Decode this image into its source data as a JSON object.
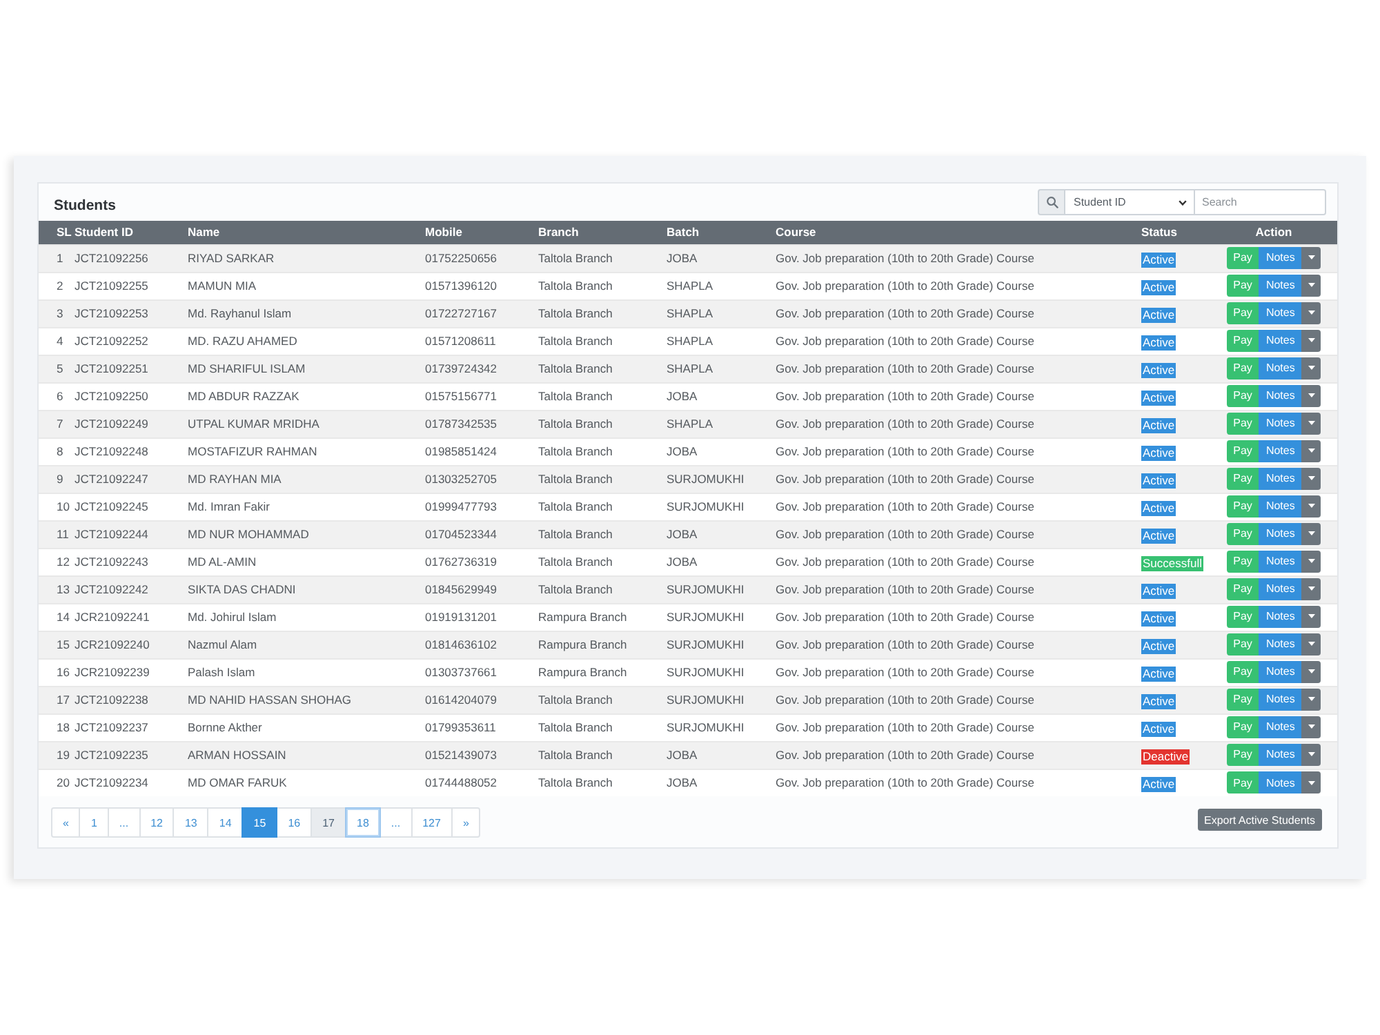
{
  "card": {
    "title": "Students",
    "search": {
      "filter": "Student ID",
      "placeholder": "Search"
    }
  },
  "table": {
    "columns": [
      "SL",
      "Student ID",
      "Name",
      "Mobile",
      "Branch",
      "Batch",
      "Course",
      "Status",
      "Action"
    ],
    "rows": [
      {
        "sl": "1",
        "student_id": "JCT21092256",
        "name": "RIYAD SARKAR",
        "mobile": "01752250656",
        "branch": "Taltola Branch",
        "batch": "JOBA",
        "course": "Gov. Job preparation (10th to 20th Grade) Course",
        "status": {
          "label": "Active",
          "color": "#3490dc"
        },
        "pay": "Pay",
        "notes": "Notes"
      },
      {
        "sl": "2",
        "student_id": "JCT21092255",
        "name": "MAMUN MIA",
        "mobile": "01571396120",
        "branch": "Taltola Branch",
        "batch": "SHAPLA",
        "course": "Gov. Job preparation (10th to 20th Grade) Course",
        "status": {
          "label": "Active",
          "color": "#3490dc"
        },
        "pay": "Pay",
        "notes": "Notes"
      },
      {
        "sl": "3",
        "student_id": "JCT21092253",
        "name": "Md. Rayhanul Islam",
        "mobile": "01722727167",
        "branch": "Taltola Branch",
        "batch": "SHAPLA",
        "course": "Gov. Job preparation (10th to 20th Grade) Course",
        "status": {
          "label": "Active",
          "color": "#3490dc"
        },
        "pay": "Pay",
        "notes": "Notes"
      },
      {
        "sl": "4",
        "student_id": "JCT21092252",
        "name": "MD. RAZU AHAMED",
        "mobile": "01571208611",
        "branch": "Taltola Branch",
        "batch": "SHAPLA",
        "course": "Gov. Job preparation (10th to 20th Grade) Course",
        "status": {
          "label": "Active",
          "color": "#3490dc"
        },
        "pay": "Pay",
        "notes": "Notes"
      },
      {
        "sl": "5",
        "student_id": "JCT21092251",
        "name": "MD SHARIFUL ISLAM",
        "mobile": "01739724342",
        "branch": "Taltola Branch",
        "batch": "SHAPLA",
        "course": "Gov. Job preparation (10th to 20th Grade) Course",
        "status": {
          "label": "Active",
          "color": "#3490dc"
        },
        "pay": "Pay",
        "notes": "Notes"
      },
      {
        "sl": "6",
        "student_id": "JCT21092250",
        "name": "MD ABDUR RAZZAK",
        "mobile": "01575156771",
        "branch": "Taltola Branch",
        "batch": "JOBA",
        "course": "Gov. Job preparation (10th to 20th Grade) Course",
        "status": {
          "label": "Active",
          "color": "#3490dc"
        },
        "pay": "Pay",
        "notes": "Notes"
      },
      {
        "sl": "7",
        "student_id": "JCT21092249",
        "name": "UTPAL KUMAR MRIDHA",
        "mobile": "01787342535",
        "branch": "Taltola Branch",
        "batch": "SHAPLA",
        "course": "Gov. Job preparation (10th to 20th Grade) Course",
        "status": {
          "label": "Active",
          "color": "#3490dc"
        },
        "pay": "Pay",
        "notes": "Notes"
      },
      {
        "sl": "8",
        "student_id": "JCT21092248",
        "name": "MOSTAFIZUR RAHMAN",
        "mobile": "01985851424",
        "branch": "Taltola Branch",
        "batch": "JOBA",
        "course": "Gov. Job preparation (10th to 20th Grade) Course",
        "status": {
          "label": "Active",
          "color": "#3490dc"
        },
        "pay": "Pay",
        "notes": "Notes"
      },
      {
        "sl": "9",
        "student_id": "JCT21092247",
        "name": "MD RAYHAN MIA",
        "mobile": "01303252705",
        "branch": "Taltola Branch",
        "batch": "SURJOMUKHI",
        "course": "Gov. Job preparation (10th to 20th Grade) Course",
        "status": {
          "label": "Active",
          "color": "#3490dc"
        },
        "pay": "Pay",
        "notes": "Notes"
      },
      {
        "sl": "10",
        "student_id": "JCT21092245",
        "name": "Md. Imran Fakir",
        "mobile": "01999477793",
        "branch": "Taltola Branch",
        "batch": "SURJOMUKHI",
        "course": "Gov. Job preparation (10th to 20th Grade) Course",
        "status": {
          "label": "Active",
          "color": "#3490dc"
        },
        "pay": "Pay",
        "notes": "Notes"
      },
      {
        "sl": "11",
        "student_id": "JCT21092244",
        "name": "MD NUR MOHAMMAD",
        "mobile": "01704523344",
        "branch": "Taltola Branch",
        "batch": "JOBA",
        "course": "Gov. Job preparation (10th to 20th Grade) Course",
        "status": {
          "label": "Active",
          "color": "#3490dc"
        },
        "pay": "Pay",
        "notes": "Notes"
      },
      {
        "sl": "12",
        "student_id": "JCT21092243",
        "name": "MD AL-AMIN",
        "mobile": "01762736319",
        "branch": "Taltola Branch",
        "batch": "JOBA",
        "course": "Gov. Job preparation (10th to 20th Grade) Course",
        "status": {
          "label": "Successfull",
          "color": "#38c172"
        },
        "pay": "Pay",
        "notes": "Notes"
      },
      {
        "sl": "13",
        "student_id": "JCT21092242",
        "name": "SIKTA DAS CHADNI",
        "mobile": "01845629949",
        "branch": "Taltola Branch",
        "batch": "SURJOMUKHI",
        "course": "Gov. Job preparation (10th to 20th Grade) Course",
        "status": {
          "label": "Active",
          "color": "#3490dc"
        },
        "pay": "Pay",
        "notes": "Notes"
      },
      {
        "sl": "14",
        "student_id": "JCR21092241",
        "name": "Md. Johirul Islam",
        "mobile": "01919131201",
        "branch": "Rampura Branch",
        "batch": "SURJOMUKHI",
        "course": "Gov. Job preparation (10th to 20th Grade) Course",
        "status": {
          "label": "Active",
          "color": "#3490dc"
        },
        "pay": "Pay",
        "notes": "Notes"
      },
      {
        "sl": "15",
        "student_id": "JCR21092240",
        "name": "Nazmul Alam",
        "mobile": "01814636102",
        "branch": "Rampura Branch",
        "batch": "SURJOMUKHI",
        "course": "Gov. Job preparation (10th to 20th Grade) Course",
        "status": {
          "label": "Active",
          "color": "#3490dc"
        },
        "pay": "Pay",
        "notes": "Notes"
      },
      {
        "sl": "16",
        "student_id": "JCR21092239",
        "name": "Palash Islam",
        "mobile": "01303737661",
        "branch": "Rampura Branch",
        "batch": "SURJOMUKHI",
        "course": "Gov. Job preparation (10th to 20th Grade) Course",
        "status": {
          "label": "Active",
          "color": "#3490dc"
        },
        "pay": "Pay",
        "notes": "Notes"
      },
      {
        "sl": "17",
        "student_id": "JCT21092238",
        "name": "MD NAHID HASSAN SHOHAG",
        "mobile": "01614204079",
        "branch": "Taltola Branch",
        "batch": "SURJOMUKHI",
        "course": "Gov. Job preparation (10th to 20th Grade) Course",
        "status": {
          "label": "Active",
          "color": "#3490dc"
        },
        "pay": "Pay",
        "notes": "Notes"
      },
      {
        "sl": "18",
        "student_id": "JCT21092237",
        "name": "Bornne Akther",
        "mobile": "01799353611",
        "branch": "Taltola Branch",
        "batch": "SURJOMUKHI",
        "course": "Gov. Job preparation (10th to 20th Grade) Course",
        "status": {
          "label": "Active",
          "color": "#3490dc"
        },
        "pay": "Pay",
        "notes": "Notes"
      },
      {
        "sl": "19",
        "student_id": "JCT21092235",
        "name": "ARMAN HOSSAIN",
        "mobile": "01521439073",
        "branch": "Taltola Branch",
        "batch": "JOBA",
        "course": "Gov. Job preparation (10th to 20th Grade) Course",
        "status": {
          "label": "Deactive",
          "color": "#e3342f"
        },
        "pay": "Pay",
        "notes": "Notes"
      },
      {
        "sl": "20",
        "student_id": "JCT21092234",
        "name": "MD OMAR FARUK",
        "mobile": "01744488052",
        "branch": "Taltola Branch",
        "batch": "JOBA",
        "course": "Gov. Job preparation (10th to 20th Grade) Course",
        "status": {
          "label": "Active",
          "color": "#3490dc"
        },
        "pay": "Pay",
        "notes": "Notes"
      }
    ]
  },
  "pagination": [
    {
      "label": "«",
      "selected": false,
      "hovered": false,
      "focused": false
    },
    {
      "label": "1",
      "selected": false,
      "hovered": false,
      "focused": false
    },
    {
      "label": "...",
      "selected": false,
      "hovered": false,
      "focused": false
    },
    {
      "label": "12",
      "selected": false,
      "hovered": false,
      "focused": false
    },
    {
      "label": "13",
      "selected": false,
      "hovered": false,
      "focused": false
    },
    {
      "label": "14",
      "selected": false,
      "hovered": false,
      "focused": false
    },
    {
      "label": "15",
      "selected": true,
      "hovered": false,
      "focused": false
    },
    {
      "label": "16",
      "selected": false,
      "hovered": false,
      "focused": false
    },
    {
      "label": "17",
      "selected": false,
      "hovered": true,
      "focused": false
    },
    {
      "label": "18",
      "selected": false,
      "hovered": false,
      "focused": true
    },
    {
      "label": "...",
      "selected": false,
      "hovered": false,
      "focused": false
    },
    {
      "label": "127",
      "selected": false,
      "hovered": false,
      "focused": false
    },
    {
      "label": "»",
      "selected": false,
      "hovered": false,
      "focused": false
    }
  ],
  "export_button": "Export Active Students"
}
